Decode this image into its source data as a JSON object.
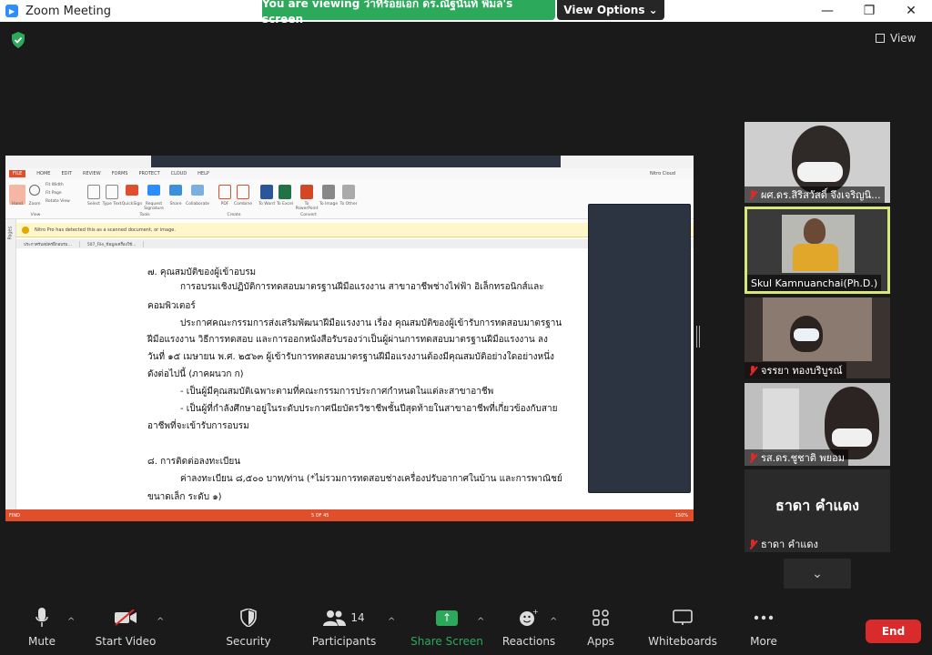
{
  "window": {
    "title": "Zoom Meeting",
    "minimize": "—",
    "maximize": "❐",
    "close": "✕"
  },
  "banner": {
    "text": "You are viewing ว่าที่ร้อยเอก ดร.ณัฐนันท์ พิมล's screen",
    "view_options": "View Options ⌄"
  },
  "top": {
    "view_label": "View"
  },
  "nitro": {
    "tabs": [
      "FILE",
      "HOME",
      "EDIT",
      "REVIEW",
      "FORMS",
      "PROTECT",
      "CLOUD",
      "HELP"
    ],
    "cloud": "Nitro Cloud",
    "notice": "Nitro Pro has detected this as a scanned document, or image.",
    "doc_tabs": [
      "ประกาศรับสมัครฝึกอบรม...",
      "507_File_ข้อมูลเครื่องใช้..."
    ],
    "pages_label": "Pages",
    "status_left": "FIND",
    "page_indicator": "5 OF 45",
    "zoom": "150%",
    "ribbon_groups": [
      "View",
      "Tools",
      "Create",
      "Convert"
    ],
    "ribbon_buttons": [
      "Hand",
      "Zoom",
      "Fit Width",
      "Fit Page",
      "Rotate View",
      "Select",
      "Type Text",
      "QuickSign",
      "Request Signature",
      "Share",
      "Collaborate",
      "PDF",
      "Combine",
      "To Word",
      "To Excel",
      "To PowerPoint",
      "To Image",
      "To Other"
    ]
  },
  "document": {
    "lines": [
      "๗. คุณสมบัติของผู้เข้าอบรม",
      "การอบรมเชิงปฏิบัติการทดสอบมาตรฐานฝีมือแรงงาน สาขาอาชีพช่างไฟฟ้า อิเล็กทรอนิกส์และ",
      "คอมพิวเตอร์",
      "ประกาศคณะกรรมการส่งเสริมพัฒนาฝีมือแรงงาน เรื่อง คุณสมบัติของผู้เข้ารับการทดสอบมาตรฐาน",
      "ฝีมือแรงงาน วิธีการทดสอบ และการออกหนังสือรับรองว่าเป็นผู้ผ่านการทดสอบมาตรฐานฝีมือแรงงาน ลง",
      "วันที่ ๑๕ เมษายน พ.ศ. ๒๕๖๓ ผู้เข้ารับการทดสอบมาตรฐานฝีมือแรงงานต้องมีคุณสมบัติอย่างใดอย่างหนึ่ง",
      "ดังต่อไปนี้ (ภาคผนวก ก)",
      "- เป็นผู้มีคุณสมบัติเฉพาะตามที่คณะกรรมการประกาศกำหนดในแต่ละสาขาอาชีพ",
      "- เป็นผู้ที่กำลังศึกษาอยู่ในระดับประกาศนียบัตรวิชาชีพชั้นปีสุดท้ายในสาขาอาชีพที่เกี่ยวข้องกับสาย",
      "อาชีพที่จะเข้ารับการอบรม",
      "๘. การติดต่อลงทะเบียน",
      "ค่าลงทะเบียน ๘,๕๐๐ บาท/ท่าน (*ไม่รวมการทดสอบช่างเครื่องปรับอากาศในบ้าน และการพาณิชย์",
      "ขนาดเล็ก ระดับ ๑)"
    ]
  },
  "participants": [
    {
      "name": "ผศ.ดร.สิริสวัสดิ์ จึงเจริญนิ...",
      "muted": true
    },
    {
      "name": "Skul Kamnuanchai(Ph.D.)",
      "muted": false,
      "active_speaker": true
    },
    {
      "name": "จรรยา ทองบริบูรณ์",
      "muted": true
    },
    {
      "name": "รส.ดร.ชูชาติ พยอม",
      "muted": true
    },
    {
      "name": "ธาดา คำแดง",
      "muted": true,
      "avatar_text": "ธาดา คำแดง"
    }
  ],
  "toolbar": {
    "mute": "Mute",
    "start_video": "Start Video",
    "security": "Security",
    "participants": "Participants",
    "participants_count": "14",
    "share_screen": "Share Screen",
    "reactions": "Reactions",
    "apps": "Apps",
    "whiteboards": "Whiteboards",
    "more": "More",
    "end": "End"
  },
  "colors": {
    "share_green": "#2da95b",
    "end_red": "#d92b2b",
    "active_speaker_border": "#d9e67a",
    "nitro_orange": "#e04f2b"
  }
}
